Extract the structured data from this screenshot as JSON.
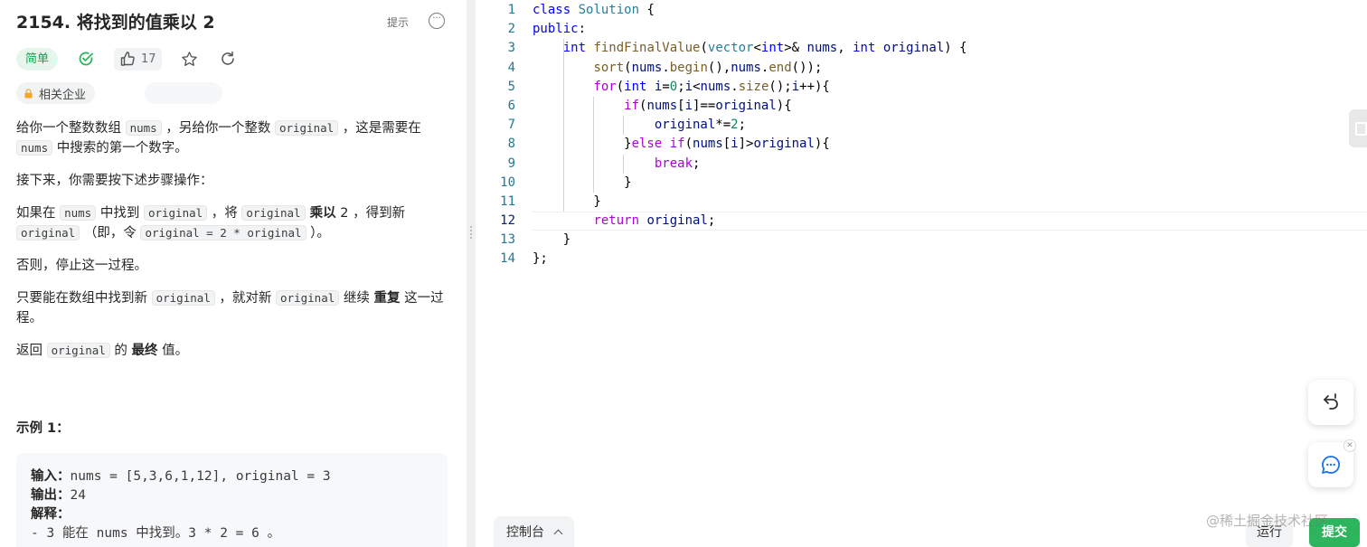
{
  "problem": {
    "title": "2154. 将找到的值乘以 2",
    "hint_label": "提示",
    "difficulty": "简单",
    "like_count": "17",
    "company_label": "相关企业"
  },
  "description": {
    "p1": {
      "t1": "给你一个整数数组 ",
      "c1": "nums",
      "t2": " ，另给你一个整数 ",
      "c2": "original",
      "t3": " ，这是需要在 ",
      "c3": "nums",
      "t4": " 中搜索的第一个数字。"
    },
    "p2": "接下来，你需要按下述步骤操作：",
    "p3": {
      "t1": "如果在 ",
      "c1": "nums",
      "t2": " 中找到 ",
      "c2": "original",
      "t3": " ，将 ",
      "c3": "original",
      "b1": " 乘以",
      "t4": " 2 ，得到新 ",
      "c4": "original",
      "t5": " （即，令 ",
      "c5": "original = 2 * original",
      "t6": " ）。"
    },
    "p4": "否则，停止这一过程。",
    "p5": {
      "t1": "只要能在数组中找到新 ",
      "c1": "original",
      "t2": " ，就对新 ",
      "c2": "original",
      "t3": " 继续 ",
      "b1": "重复",
      "t4": " 这一过程。"
    },
    "p6": {
      "t1": "返回 ",
      "c1": "original",
      "t2": " 的 ",
      "b1": "最终",
      "t3": " 值。"
    }
  },
  "example": {
    "title": "示例 1：",
    "input_label": "输入：",
    "input_value": "nums = [5,3,6,1,12], original = 3",
    "output_label": "输出：",
    "output_value": "24",
    "explain_label": "解释：",
    "explain_line1": "- 3 能在 nums 中找到。3 * 2 = 6 。"
  },
  "editor": {
    "current_line": "12",
    "line_numbers": [
      "1",
      "2",
      "3",
      "4",
      "5",
      "6",
      "7",
      "8",
      "9",
      "10",
      "11",
      "12",
      "13",
      "14"
    ]
  },
  "bottom": {
    "console_label": "控制台",
    "run_label": "运行",
    "submit_label": "提交",
    "watermark": "@稀土掘金技术社区"
  },
  "colors": {
    "accent_green": "#2db55d",
    "easy_badge_text": "#17a34a",
    "easy_badge_bg": "#e7f6ed",
    "keyword": "#0000ff",
    "type": "#267f99",
    "function": "#795e26",
    "control": "#af00db",
    "number": "#098658",
    "line_number": "#237893"
  },
  "icons": [
    "more-icon",
    "check-circle-icon",
    "thumbs-up-icon",
    "star-icon",
    "refresh-icon",
    "lock-icon",
    "chevron-up-icon",
    "reset-code-icon",
    "feedback-chat-icon",
    "close-icon",
    "side-panel-icon"
  ]
}
